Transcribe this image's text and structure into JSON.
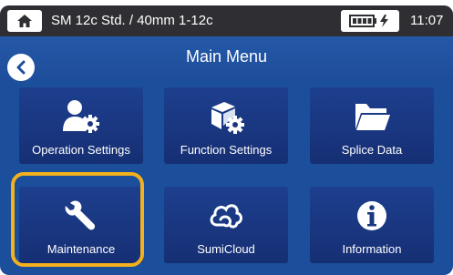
{
  "status_bar": {
    "title": "SM 12c Std. / 40mm 1-12c",
    "time": "11:07",
    "home_icon": "home-icon",
    "battery_icon": "battery-charging-icon"
  },
  "header": {
    "title": "Main Menu",
    "back_icon": "chevron-left-icon"
  },
  "menu": {
    "items": [
      {
        "label": "Operation Settings",
        "icon": "user-gear-icon"
      },
      {
        "label": "Function Settings",
        "icon": "box-gear-icon"
      },
      {
        "label": "Splice Data",
        "icon": "folder-icon"
      },
      {
        "label": "Maintenance",
        "icon": "wrench-icon"
      },
      {
        "label": "SumiCloud",
        "icon": "cloud-icon"
      },
      {
        "label": "Information",
        "icon": "info-icon"
      }
    ]
  },
  "colors": {
    "background": "#1b4f9c",
    "status_bar": "#2f2f33",
    "tile": "#1d3f8e",
    "highlight": "#f2b11d"
  }
}
